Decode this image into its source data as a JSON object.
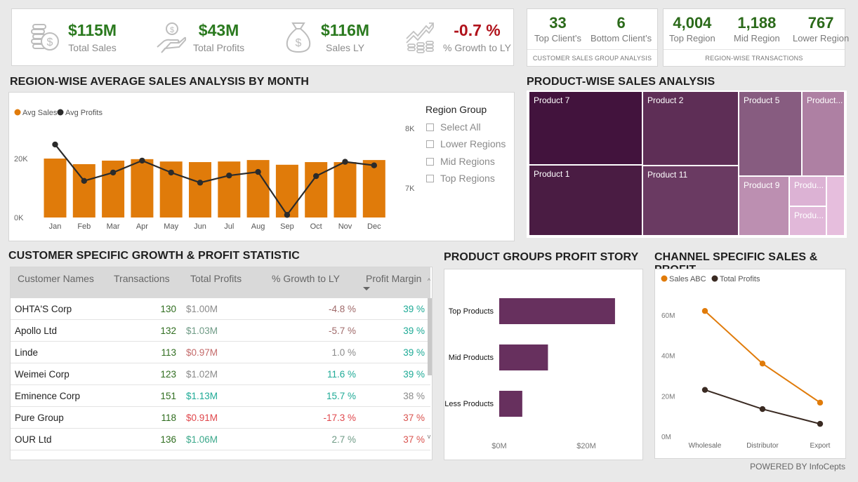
{
  "kpis": [
    {
      "value": "$115M",
      "label": "Total Sales",
      "icon": "coins-dollar-icon",
      "negative": false
    },
    {
      "value": "$43M",
      "label": "Total Profits",
      "icon": "hand-coin-icon",
      "negative": false
    },
    {
      "value": "$116M",
      "label": "Sales LY",
      "icon": "money-bag-icon",
      "negative": false
    },
    {
      "value": "-0.7 %",
      "label": "% Growth to LY",
      "icon": "growth-chart-icon",
      "negative": true
    }
  ],
  "customer_group": {
    "items": [
      {
        "value": "33",
        "label": "Top Client’s"
      },
      {
        "value": "6",
        "label": "Bottom Client’s"
      }
    ],
    "footer": "CUSTOMER SALES GROUP ANALYSIS"
  },
  "region_transactions": {
    "items": [
      {
        "value": "4,004",
        "label": "Top Region"
      },
      {
        "value": "1,188",
        "label": "Mid Region"
      },
      {
        "value": "767",
        "label": "Lower Region"
      }
    ],
    "footer": "REGION-WISE TRANSACTIONS"
  },
  "titles": {
    "monthly": "REGION-WISE AVERAGE SALES ANALYSIS BY MONTH",
    "treemap": "PRODUCT-WISE SALES ANALYSIS",
    "table": "CUSTOMER SPECIFIC GROWTH & PROFIT STATISTIC",
    "product_groups": "PRODUCT GROUPS PROFIT STORY",
    "channel": "CHANNEL SPECIFIC SALES & PROFIT"
  },
  "region_filter": {
    "title": "Region Group",
    "options": [
      "Select All",
      "Lower Regions",
      "Mid Regions",
      "Top Regions"
    ]
  },
  "treemap": {
    "tiles": [
      {
        "label": "Product 7",
        "color": "#42133d"
      },
      {
        "label": "Product 1",
        "color": "#4a1c43"
      },
      {
        "label": "Product 2",
        "color": "#5e2e56"
      },
      {
        "label": "Product 11",
        "color": "#6a3a62"
      },
      {
        "label": "Product 5",
        "color": "#875c80"
      },
      {
        "label": "Product...",
        "color": "#ae80a3"
      },
      {
        "label": "Product 9",
        "color": "#bc8fb1"
      },
      {
        "label": "Produ...",
        "color": "#dcb2d4"
      },
      {
        "label": "Produ...",
        "color": "#e1b8d9"
      },
      {
        "label": "",
        "color": "#e6bedd"
      }
    ]
  },
  "table": {
    "columns": [
      "Customer Names",
      "Transactions",
      "Total Profits",
      "% Growth to LY",
      "Profit Margin"
    ],
    "rows": [
      {
        "name": "OHTA'S Corp",
        "transactions": "130",
        "profits": "$1.00M",
        "profits_color": "#8a8a8a",
        "growth": "-4.8 %",
        "growth_color": "#a06a6a",
        "margin": "39 %",
        "margin_color": "#1eaa96"
      },
      {
        "name": "Apollo Ltd",
        "transactions": "132",
        "profits": "$1.03M",
        "profits_color": "#6e9a85",
        "growth": "-5.7 %",
        "growth_color": "#a06a6a",
        "margin": "39 %",
        "margin_color": "#1eaa96"
      },
      {
        "name": "Linde",
        "transactions": "113",
        "profits": "$0.97M",
        "profits_color": "#c46a6a",
        "growth": "1.0 %",
        "growth_color": "#8a8a8a",
        "margin": "39 %",
        "margin_color": "#1eaa96"
      },
      {
        "name": "Weimei Corp",
        "transactions": "123",
        "profits": "$1.02M",
        "profits_color": "#8a8a8a",
        "growth": "11.6 %",
        "growth_color": "#1eaa96",
        "margin": "39 %",
        "margin_color": "#1eaa96"
      },
      {
        "name": "Eminence Corp",
        "transactions": "151",
        "profits": "$1.13M",
        "profits_color": "#1eaa96",
        "growth": "15.7 %",
        "growth_color": "#1eaa96",
        "margin": "38 %",
        "margin_color": "#8a8a8a"
      },
      {
        "name": "Pure Group",
        "transactions": "118",
        "profits": "$0.91M",
        "profits_color": "#e0474c",
        "growth": "-17.3 %",
        "growth_color": "#e0474c",
        "margin": "37 %",
        "margin_color": "#d9534f"
      },
      {
        "name": "OUR Ltd",
        "transactions": "136",
        "profits": "$1.06M",
        "profits_color": "#3aa88a",
        "growth": "2.7 %",
        "growth_color": "#6e9a85",
        "margin": "37 %",
        "margin_color": "#d9534f"
      }
    ]
  },
  "footer": {
    "powered_by": "POWERED BY InfoCepts"
  },
  "chart_data": [
    {
      "id": "monthly",
      "type": "bar",
      "title": "REGION-WISE AVERAGE SALES ANALYSIS BY MONTH",
      "categories": [
        "Jan",
        "Feb",
        "Mar",
        "Apr",
        "May",
        "Jun",
        "Jul",
        "Aug",
        "Sep",
        "Oct",
        "Nov",
        "Dec"
      ],
      "series": [
        {
          "name": "Avg Sales",
          "type": "bar",
          "axis": "left",
          "color": "#e07b0a",
          "values": [
            20000,
            18100,
            19300,
            19800,
            19000,
            18800,
            19000,
            19500,
            17900,
            18800,
            18800,
            19500
          ]
        },
        {
          "name": "Avg Profits",
          "type": "line",
          "axis": "right",
          "color": "#2b2b2b",
          "values": [
            7730,
            7120,
            7260,
            7460,
            7260,
            7090,
            7210,
            7270,
            6550,
            7200,
            7440,
            7380
          ]
        }
      ],
      "left_axis": {
        "ticks": [
          "0K",
          "20K"
        ],
        "tick_values": [
          0,
          20000
        ],
        "range": [
          0,
          20000
        ]
      },
      "right_axis": {
        "ticks": [
          "7K",
          "8K"
        ],
        "tick_values": [
          7000,
          8000
        ],
        "range": [
          7000,
          8000
        ]
      },
      "legend": "top-left",
      "grid": false
    },
    {
      "id": "product_groups",
      "type": "bar",
      "orientation": "horizontal",
      "title": "PRODUCT GROUPS PROFIT STORY",
      "categories": [
        "Top Products",
        "Mid Products",
        "Less Products"
      ],
      "values": [
        26.6,
        11.2,
        5.3
      ],
      "unit": "$M",
      "color": "#67305e",
      "x_ticks": [
        "$0M",
        "$20M"
      ],
      "x_tick_values": [
        0,
        20
      ],
      "xlim": [
        0,
        32
      ]
    },
    {
      "id": "channel",
      "type": "line",
      "title": "CHANNEL SPECIFIC SALES & PROFIT",
      "categories": [
        "Wholesale",
        "Distributor",
        "Export"
      ],
      "series": [
        {
          "name": "Sales ABC",
          "color": "#e07b0a",
          "values": [
            62,
            36,
            16.7
          ]
        },
        {
          "name": "Total Profits",
          "color": "#3a2a22",
          "values": [
            23,
            13.5,
            6.2
          ]
        }
      ],
      "unit": "M",
      "y_ticks": [
        "0M",
        "20M",
        "40M",
        "60M"
      ],
      "y_tick_values": [
        0,
        20,
        40,
        60
      ],
      "ylim": [
        0,
        60
      ],
      "legend": "top-left"
    }
  ]
}
